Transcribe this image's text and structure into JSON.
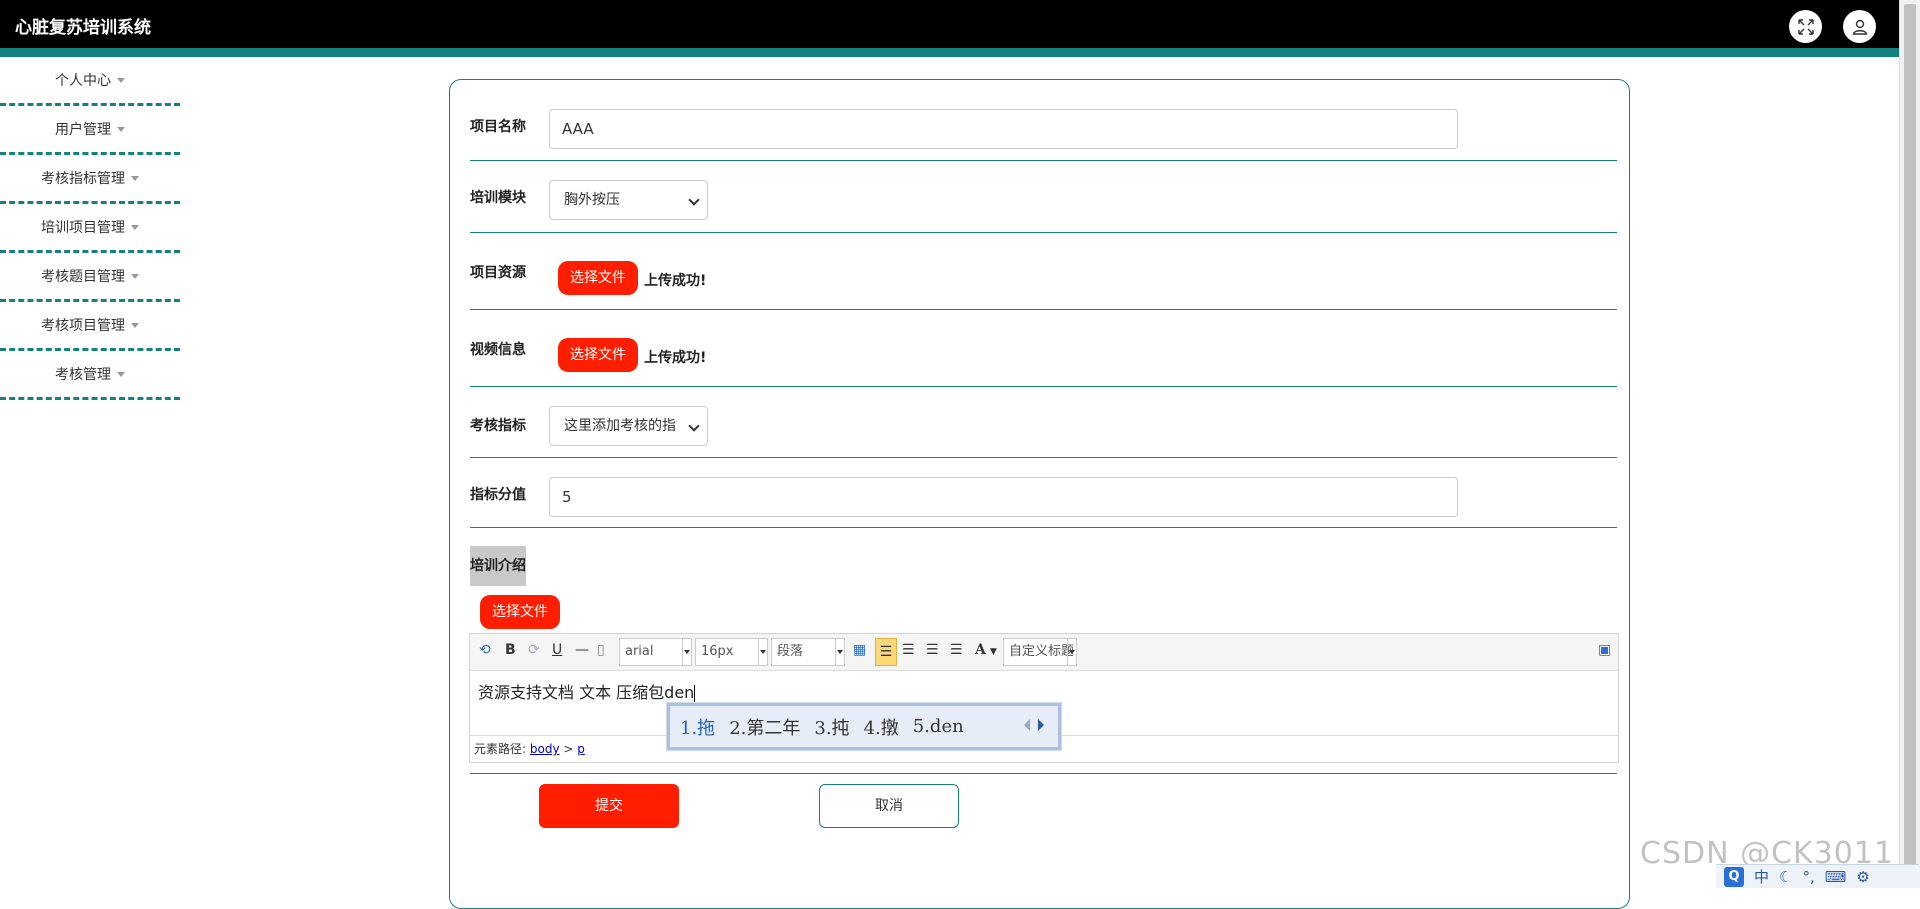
{
  "app": {
    "title": "心脏复苏培训系统"
  },
  "header": {
    "icons": [
      "fullscreen-icon",
      "user-icon"
    ]
  },
  "sidebar": {
    "items": [
      {
        "label": "个人中心"
      },
      {
        "label": "用户管理"
      },
      {
        "label": "考核指标管理"
      },
      {
        "label": "培训项目管理"
      },
      {
        "label": "考核题目管理"
      },
      {
        "label": "考核项目管理"
      },
      {
        "label": "考核管理"
      }
    ]
  },
  "form": {
    "project_name": {
      "label": "项目名称",
      "value": "AAA"
    },
    "training_module": {
      "label": "培训模块",
      "value": "胸外按压"
    },
    "project_resource": {
      "label": "项目资源",
      "button": "选择文件",
      "status": "上传成功!"
    },
    "video_info": {
      "label": "视频信息",
      "button": "选择文件",
      "status": "上传成功!"
    },
    "assessment_indicator": {
      "label": "考核指标",
      "value": "这里添加考核的指"
    },
    "indicator_score": {
      "label": "指标分值",
      "value": "5"
    },
    "training_intro": {
      "label": "培训介绍",
      "button": "选择文件"
    }
  },
  "editor": {
    "font_family": "arial",
    "font_size": "16px",
    "paragraph": "段落",
    "custom_title": "自定义标题",
    "bold_label": "B",
    "underline_label": "U",
    "fontcolor_label": "A",
    "content": "资源支持文档 文本 压缩包den",
    "path_label": "元素路径:",
    "path_body": "body",
    "path_sep": ">",
    "path_p": "p"
  },
  "ime": {
    "candidates": [
      "1.拖",
      "2.第二年",
      "3.扽",
      "4.撴",
      "5.den"
    ]
  },
  "actions": {
    "submit": "提交",
    "cancel": "取消"
  },
  "watermark": "CSDN @CK3011",
  "tray": {
    "q": "Q",
    "lang": "中"
  },
  "colors": {
    "accent": "#15817f",
    "danger": "#ff1e00",
    "topbar": "#000000"
  }
}
